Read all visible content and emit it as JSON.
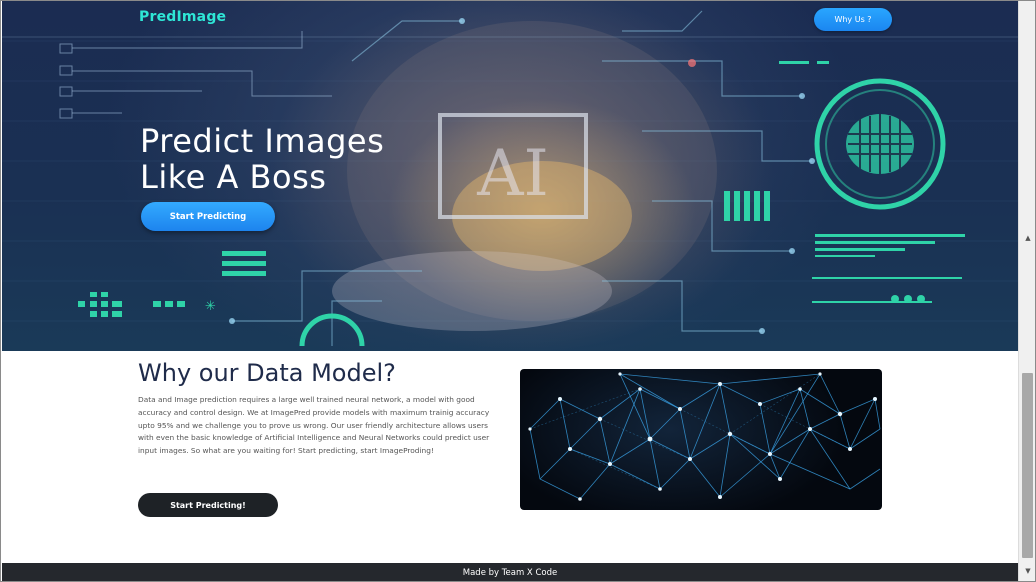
{
  "header": {
    "brand": "PredImage",
    "why_button": "Why Us ?"
  },
  "hero": {
    "title_line1": "Predict Images",
    "title_line2": "Like A Boss",
    "cta": "Start Predicting",
    "badge_text": "AI"
  },
  "about": {
    "title": "Why our Data Model?",
    "body": "Data and Image prediction requires a large well trained neural network, a model with good accuracy and control design. We at ImagePred provide models with maximum trainig accuracy upto 95% and we challenge you to prove us wrong. Our user friendly architecture allows users with even the basic knowledge of Artificial Intelligence and Neural Networks could predict user input images. So what are you waiting for! Start predicting, start ImageProding!",
    "cta": "Start Predicting!"
  },
  "footer": {
    "text": "Made by Team X Code"
  },
  "colors": {
    "brand": "#2ee6d6",
    "primary_button": "#1b86f0",
    "dark_button": "#1e2226",
    "footer_bg": "#25282d",
    "circuit": "#2fd3a8"
  }
}
